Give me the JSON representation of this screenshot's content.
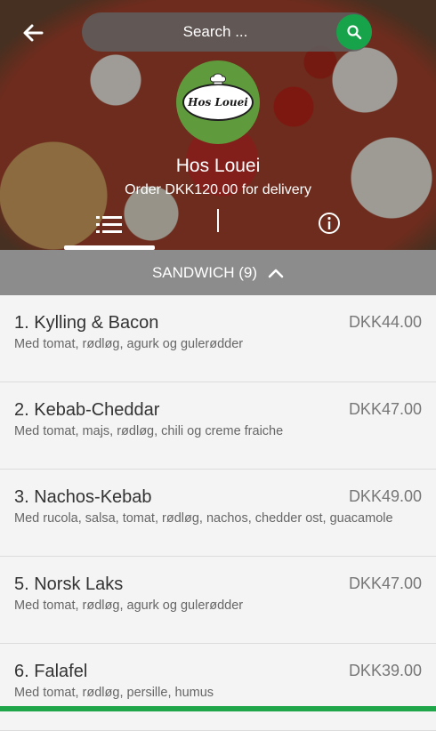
{
  "header": {
    "search_placeholder": "Search ...",
    "restaurant_name": "Hos Louei",
    "logo_text": "Hos Louei",
    "delivery_note": "Order DKK120.00 for delivery"
  },
  "colors": {
    "accent_green": "#17a34a",
    "category_bar": "#8c8c8c",
    "logo_green": "#5f9a3c"
  },
  "icons": {
    "back": "arrow-left-icon",
    "search": "search-icon",
    "menu_tab": "list-icon",
    "info_tab": "info-icon",
    "collapse": "chevron-up-icon"
  },
  "category": {
    "label": "SANDWICH (9)"
  },
  "items": [
    {
      "name": "1. Kylling & Bacon",
      "price": "DKK44.00",
      "desc": "Med tomat, rødløg, agurk og gulerødder"
    },
    {
      "name": "2. Kebab-Cheddar",
      "price": "DKK47.00",
      "desc": "Med tomat, majs, rødløg, chili og creme fraiche"
    },
    {
      "name": "3. Nachos-Kebab",
      "price": "DKK49.00",
      "desc": "Med rucola, salsa, tomat, rødløg, nachos, chedder ost, guacamole"
    },
    {
      "name": "5. Norsk Laks",
      "price": "DKK47.00",
      "desc": "Med tomat, rødløg, agurk og gulerødder"
    },
    {
      "name": "6. Falafel",
      "price": "DKK39.00",
      "desc": "Med tomat, rødløg, persille, humus"
    }
  ]
}
